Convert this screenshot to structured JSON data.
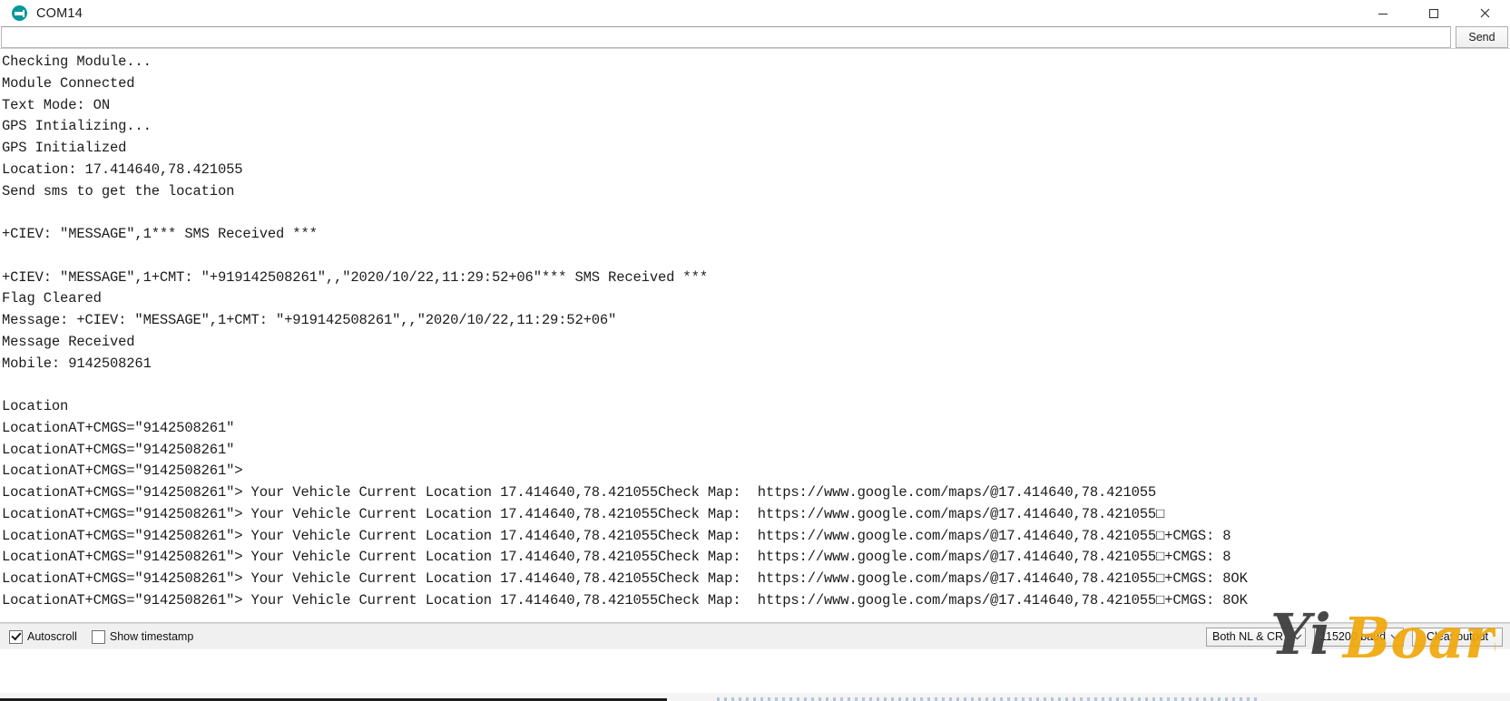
{
  "window": {
    "title": "COM14",
    "icon": "arduino-logo-icon",
    "controls": {
      "minimize": "minimize-icon",
      "maximize": "maximize-icon",
      "close": "close-icon"
    }
  },
  "send_row": {
    "input_value": "",
    "input_placeholder": "",
    "send_label": "Send"
  },
  "console": {
    "lines": [
      "Checking Module...",
      "Module Connected",
      "Text Mode: ON",
      "GPS Intializing...",
      "GPS Initialized",
      "Location: 17.414640,78.421055",
      "Send sms to get the location",
      "",
      "+CIEV: \"MESSAGE\",1*** SMS Received ***",
      "",
      "+CIEV: \"MESSAGE\",1+CMT: \"+919142508261\",,\"2020/10/22,11:29:52+06\"*** SMS Received ***",
      "Flag Cleared",
      "Message: +CIEV: \"MESSAGE\",1+CMT: \"+919142508261\",,\"2020/10/22,11:29:52+06\"",
      "Message Received",
      "Mobile: 9142508261",
      "",
      "Location",
      "LocationAT+CMGS=\"9142508261\"",
      "LocationAT+CMGS=\"9142508261\"",
      "LocationAT+CMGS=\"9142508261\">",
      "LocationAT+CMGS=\"9142508261\"> Your Vehicle Current Location 17.414640,78.421055Check Map:  https://www.google.com/maps/@17.414640,78.421055",
      "LocationAT+CMGS=\"9142508261\"> Your Vehicle Current Location 17.414640,78.421055Check Map:  https://www.google.com/maps/@17.414640,78.421055□",
      "LocationAT+CMGS=\"9142508261\"> Your Vehicle Current Location 17.414640,78.421055Check Map:  https://www.google.com/maps/@17.414640,78.421055□+CMGS: 8",
      "LocationAT+CMGS=\"9142508261\"> Your Vehicle Current Location 17.414640,78.421055Check Map:  https://www.google.com/maps/@17.414640,78.421055□+CMGS: 8",
      "LocationAT+CMGS=\"9142508261\"> Your Vehicle Current Location 17.414640,78.421055Check Map:  https://www.google.com/maps/@17.414640,78.421055□+CMGS: 8OK",
      "LocationAT+CMGS=\"9142508261\"> Your Vehicle Current Location 17.414640,78.421055Check Map:  https://www.google.com/maps/@17.414640,78.421055□+CMGS: 8OK"
    ]
  },
  "statusbar": {
    "autoscroll": {
      "label": "Autoscroll",
      "checked": true
    },
    "show_timestamp": {
      "label": "Show timestamp",
      "checked": false
    },
    "line_ending": {
      "value": "Both NL & CR"
    },
    "baud_rate": {
      "value": "115200 baud"
    },
    "clear_output": {
      "label": "Clear output"
    }
  },
  "watermark": {
    "text_dark": "Yi",
    "text_gold": "Board",
    "color_dark": "#3b3b3b",
    "color_gold": "#f0a80c"
  },
  "colors": {
    "accent_teal": "#00979c",
    "window_bg": "#ffffff",
    "statusbar_bg": "#f0f0f0",
    "console_text": "#1c1c1c"
  }
}
